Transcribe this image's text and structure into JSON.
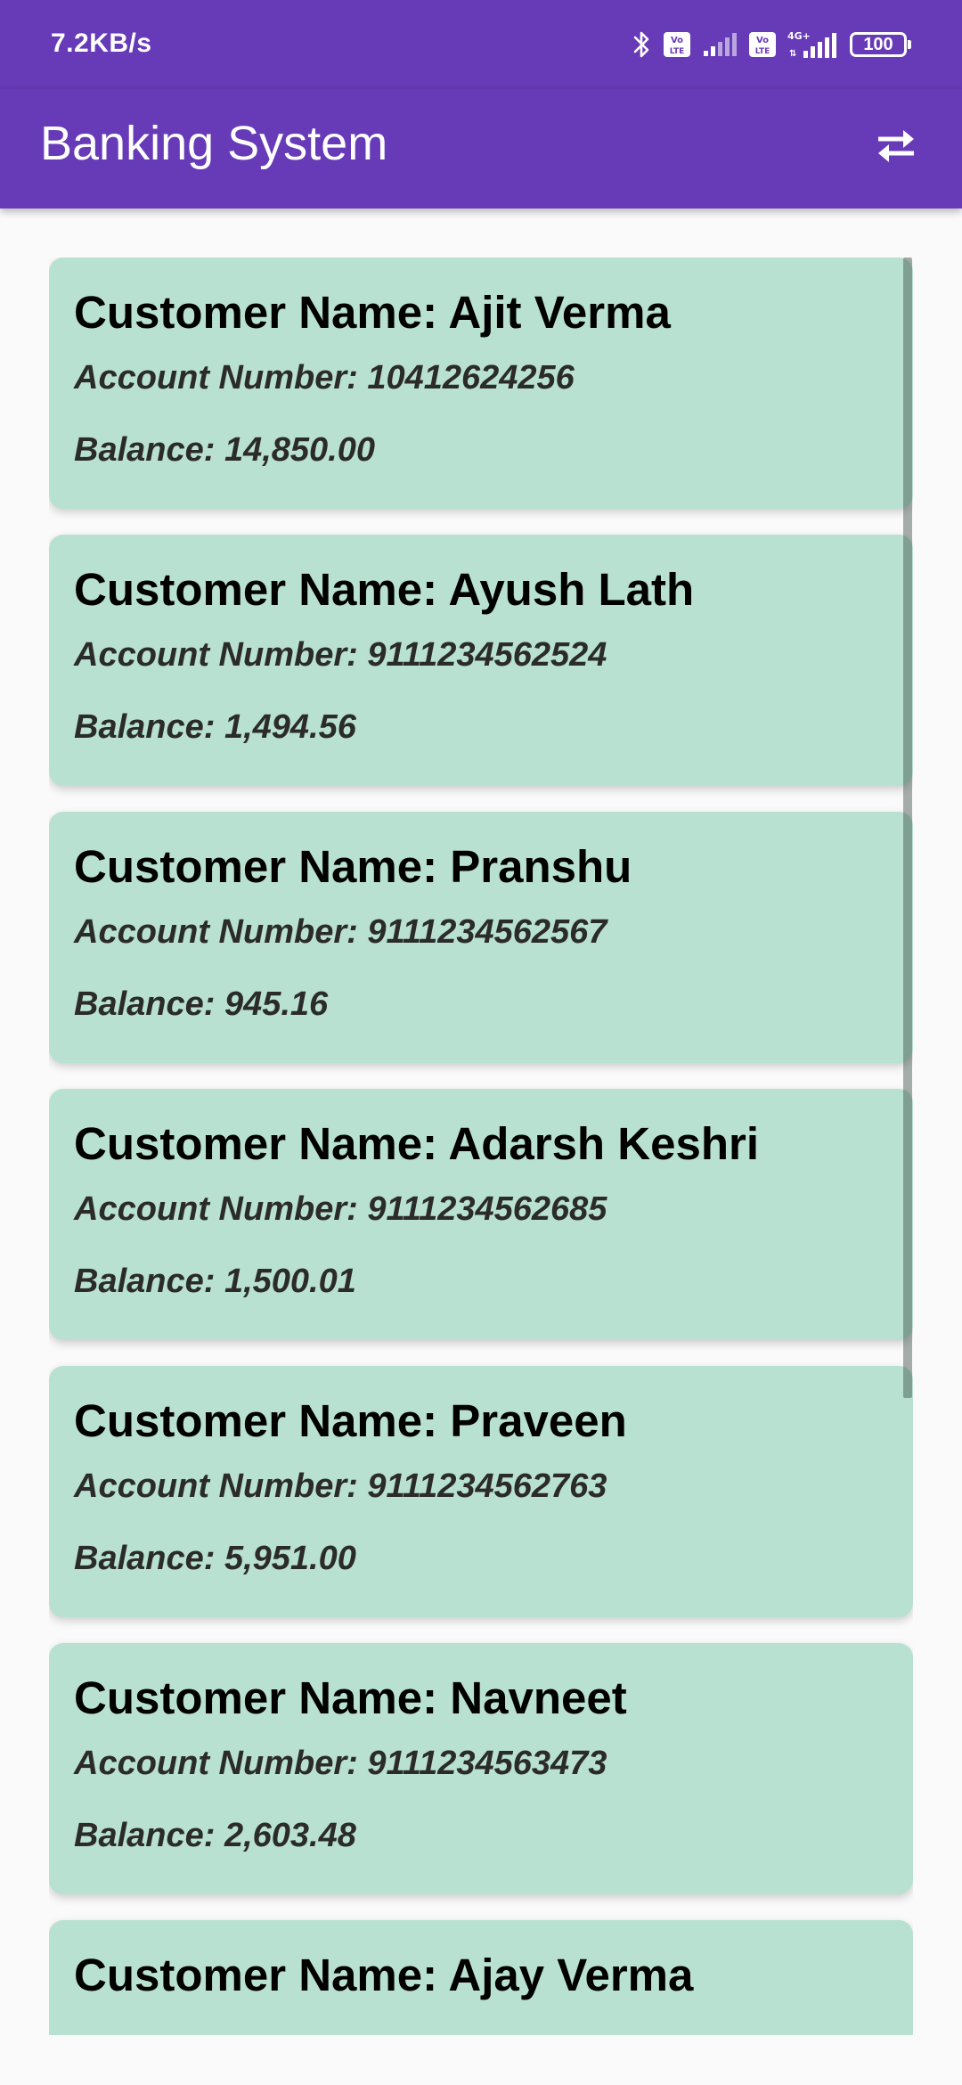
{
  "status_bar": {
    "net_speed": "7.2KB/s",
    "battery_level": "100",
    "icons": [
      "bluetooth-icon",
      "volte-icon",
      "signal-icon",
      "volte-icon",
      "4g-signal-icon",
      "battery-icon"
    ]
  },
  "app_bar": {
    "title": "Banking System",
    "action_icon": "swap-arrows-icon"
  },
  "colors": {
    "primary": "#673ab7",
    "card_background": "#b9e1d1",
    "page_background": "#fafafa"
  },
  "customers": [
    {
      "name": "Customer Name: Ajit Verma",
      "account": "Account Number: 10412624256",
      "balance": "Balance: 14,850.00"
    },
    {
      "name": "Customer Name: Ayush Lath",
      "account": "Account Number: 9111234562524",
      "balance": "Balance: 1,494.56"
    },
    {
      "name": "Customer Name: Pranshu",
      "account": "Account Number: 9111234562567",
      "balance": "Balance: 945.16"
    },
    {
      "name": "Customer Name: Adarsh Keshri",
      "account": "Account Number: 9111234562685",
      "balance": "Balance: 1,500.01"
    },
    {
      "name": "Customer Name: Praveen",
      "account": "Account Number: 9111234562763",
      "balance": "Balance: 5,951.00"
    },
    {
      "name": "Customer Name: Navneet",
      "account": "Account Number: 9111234563473",
      "balance": "Balance: 2,603.48"
    },
    {
      "name": "Customer Name: Ajay Verma",
      "account": "",
      "balance": ""
    }
  ]
}
